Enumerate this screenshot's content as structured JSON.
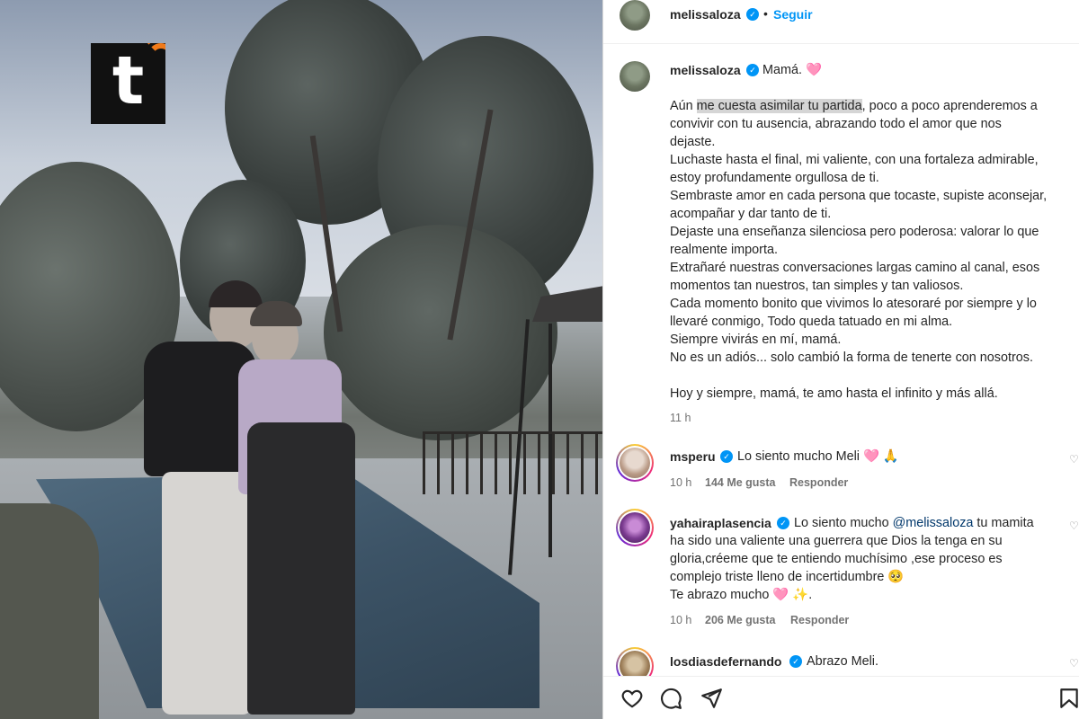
{
  "post": {
    "author": "melissaloza",
    "follow_label": "Seguir",
    "separator": "•"
  },
  "caption": {
    "author": "melissaloza",
    "title": "Mamá. 🩷",
    "lines_first_prefix": "Aún ",
    "highlighted": "me cuesta asimilar tu partida",
    "lines_first_suffix": ", poco a poco aprenderemos a",
    "lines": [
      "convivir con tu ausencia, abrazando todo el amor que nos",
      "dejaste.",
      "Luchaste hasta el final, mi valiente, con una fortaleza admirable,",
      "estoy profundamente orgullosa de ti.",
      "Sembraste amor en cada persona que tocaste, supiste aconsejar,",
      "acompañar y dar tanto de ti.",
      "Dejaste una enseñanza silenciosa pero poderosa: valorar lo que",
      "realmente importa.",
      "Extrañaré nuestras conversaciones largas camino al canal, esos",
      "momentos tan nuestros, tan simples y tan valiosos.",
      "Cada momento bonito que vivimos lo atesoraré por siempre y lo",
      "llevaré conmigo, Todo queda tatuado en mi alma.",
      "Siempre vivirás en mí, mamá.",
      "No es un adiós... solo cambió la forma de tenerte con nosotros."
    ],
    "closing": "Hoy y siempre, mamá, te amo hasta el infinito y más allá.",
    "time": "11 h"
  },
  "comments": [
    {
      "user": "msperu",
      "text": "Lo siento mucho Meli 🩷 🙏",
      "time": "10 h",
      "likes": "144 Me gusta",
      "reply": "Responder"
    },
    {
      "user": "yahairaplasencia",
      "line1_prefix": "Lo siento mucho ",
      "mention": "@melissaloza",
      "line1_suffix": " tu mamita",
      "lines": [
        "ha sido una valiente una guerrera que Dios la tenga en su",
        "gloria,créeme que te entiendo muchísimo ,ese proceso es",
        "complejo triste lleno de incertidumbre 🥺",
        "Te abrazo mucho 🩷 ✨."
      ],
      "time": "10 h",
      "likes": "206 Me gusta",
      "reply": "Responder"
    },
    {
      "user": "losdiasdefernando",
      "text": "Abrazo Meli."
    }
  ],
  "icons": {
    "like": "heart-icon",
    "comment": "comment-icon",
    "share": "share-icon",
    "save": "bookmark-icon",
    "verified": "verified-icon"
  },
  "colors": {
    "link": "#0095f6",
    "verified": "#0095f6",
    "watermark_accent": "#f07a1a"
  }
}
